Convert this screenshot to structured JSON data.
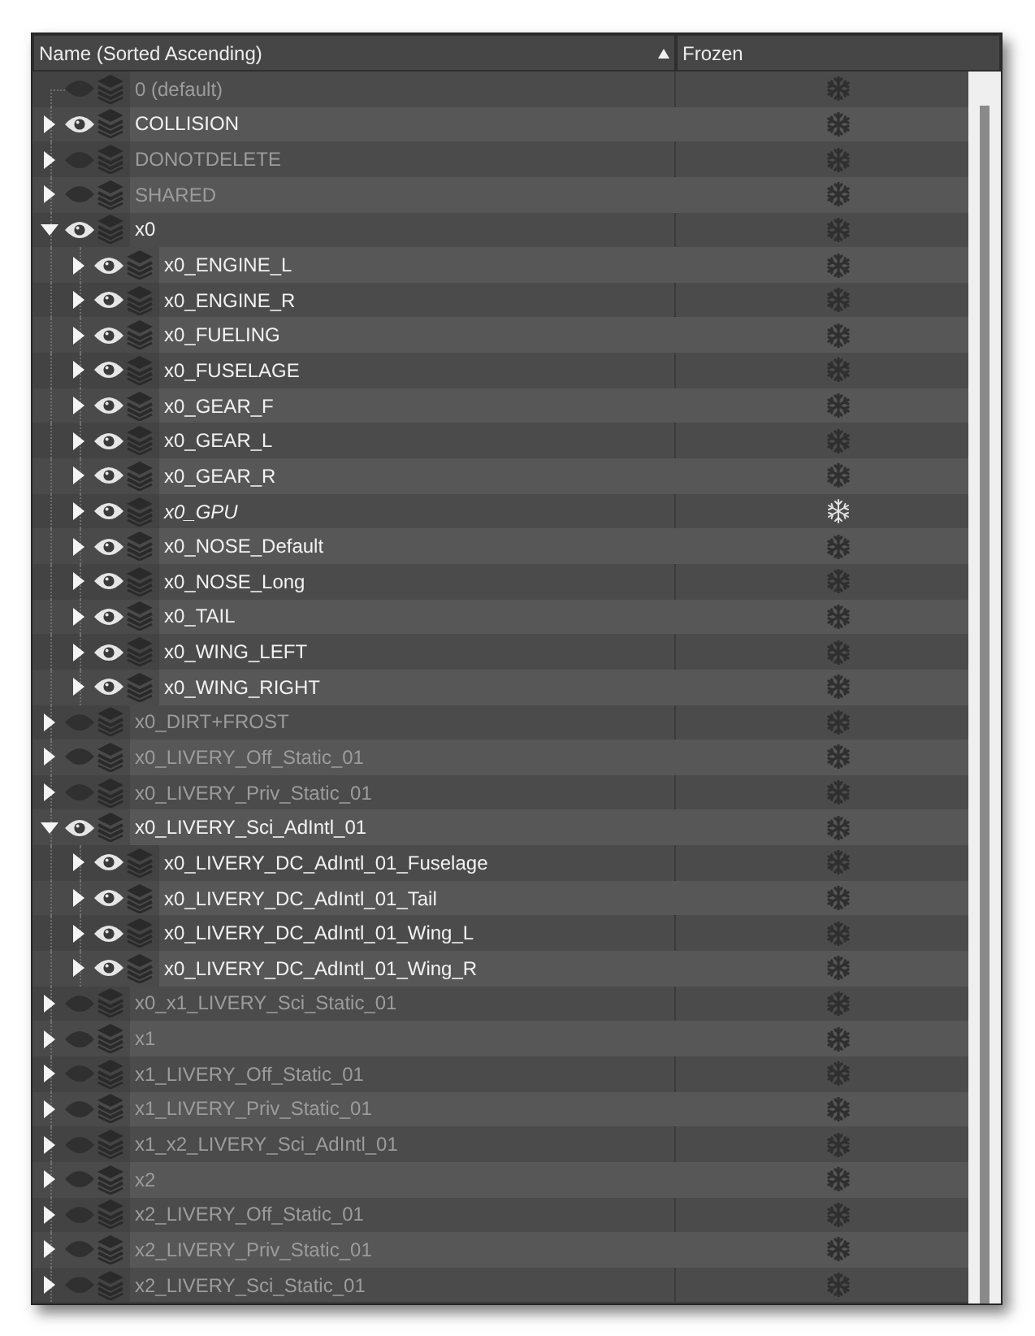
{
  "columns": [
    {
      "label": "Name (Sorted Ascending)",
      "sorted": true
    },
    {
      "label": "Frozen",
      "sorted": false
    }
  ],
  "rows": [
    {
      "name": "0 (default)",
      "kind": "default",
      "visible": false,
      "frozen": false
    },
    {
      "name": "COLLISION",
      "kind": "layer",
      "expanded": false,
      "visible": true,
      "frozen": false
    },
    {
      "name": "DONOTDELETE",
      "kind": "layer",
      "expanded": false,
      "visible": false,
      "frozen": false
    },
    {
      "name": "SHARED",
      "kind": "layer",
      "expanded": false,
      "visible": false,
      "frozen": false
    },
    {
      "name": "x0",
      "kind": "layer",
      "expanded": true,
      "visible": true,
      "frozen": false,
      "children": [
        {
          "name": "x0_ENGINE_L",
          "kind": "layer",
          "expanded": false,
          "visible": true,
          "frozen": false
        },
        {
          "name": "x0_ENGINE_R",
          "kind": "layer",
          "expanded": false,
          "visible": true,
          "frozen": false
        },
        {
          "name": "x0_FUELING",
          "kind": "layer",
          "expanded": false,
          "visible": true,
          "frozen": false
        },
        {
          "name": "x0_FUSELAGE",
          "kind": "layer",
          "expanded": false,
          "visible": true,
          "frozen": false
        },
        {
          "name": "x0_GEAR_F",
          "kind": "layer",
          "expanded": false,
          "visible": true,
          "frozen": false
        },
        {
          "name": "x0_GEAR_L",
          "kind": "layer",
          "expanded": false,
          "visible": true,
          "frozen": false
        },
        {
          "name": "x0_GEAR_R",
          "kind": "layer",
          "expanded": false,
          "visible": true,
          "frozen": false
        },
        {
          "name": "x0_GPU",
          "kind": "layer",
          "expanded": false,
          "visible": true,
          "frozen": true
        },
        {
          "name": "x0_NOSE_Default",
          "kind": "layer",
          "expanded": false,
          "visible": true,
          "frozen": false
        },
        {
          "name": "x0_NOSE_Long",
          "kind": "layer",
          "expanded": false,
          "visible": true,
          "frozen": false
        },
        {
          "name": "x0_TAIL",
          "kind": "layer",
          "expanded": false,
          "visible": true,
          "frozen": false
        },
        {
          "name": "x0_WING_LEFT",
          "kind": "layer",
          "expanded": false,
          "visible": true,
          "frozen": false
        },
        {
          "name": "x0_WING_RIGHT",
          "kind": "layer",
          "expanded": false,
          "visible": true,
          "frozen": false
        }
      ]
    },
    {
      "name": "x0_DIRT+FROST",
      "kind": "layer",
      "expanded": false,
      "visible": false,
      "frozen": false
    },
    {
      "name": "x0_LIVERY_Off_Static_01",
      "kind": "layer",
      "expanded": false,
      "visible": false,
      "frozen": false
    },
    {
      "name": "x0_LIVERY_Priv_Static_01",
      "kind": "layer",
      "expanded": false,
      "visible": false,
      "frozen": false
    },
    {
      "name": "x0_LIVERY_Sci_AdIntl_01",
      "kind": "layer",
      "expanded": true,
      "visible": true,
      "frozen": false,
      "children": [
        {
          "name": "x0_LIVERY_DC_AdIntl_01_Fuselage",
          "kind": "layer",
          "expanded": false,
          "visible": true,
          "frozen": false
        },
        {
          "name": "x0_LIVERY_DC_AdIntl_01_Tail",
          "kind": "layer",
          "expanded": false,
          "visible": true,
          "frozen": false
        },
        {
          "name": "x0_LIVERY_DC_AdIntl_01_Wing_L",
          "kind": "layer",
          "expanded": false,
          "visible": true,
          "frozen": false
        },
        {
          "name": "x0_LIVERY_DC_AdIntl_01_Wing_R",
          "kind": "layer",
          "expanded": false,
          "visible": true,
          "frozen": false
        }
      ]
    },
    {
      "name": "x0_x1_LIVERY_Sci_Static_01",
      "kind": "layer",
      "expanded": false,
      "visible": false,
      "frozen": false
    },
    {
      "name": "x1",
      "kind": "layer",
      "expanded": false,
      "visible": false,
      "frozen": false
    },
    {
      "name": "x1_LIVERY_Off_Static_01",
      "kind": "layer",
      "expanded": false,
      "visible": false,
      "frozen": false
    },
    {
      "name": "x1_LIVERY_Priv_Static_01",
      "kind": "layer",
      "expanded": false,
      "visible": false,
      "frozen": false
    },
    {
      "name": "x1_x2_LIVERY_Sci_AdIntl_01",
      "kind": "layer",
      "expanded": false,
      "visible": false,
      "frozen": false
    },
    {
      "name": "x2",
      "kind": "layer",
      "expanded": false,
      "visible": false,
      "frozen": false
    },
    {
      "name": "x2_LIVERY_Off_Static_01",
      "kind": "layer",
      "expanded": false,
      "visible": false,
      "frozen": false
    },
    {
      "name": "x2_LIVERY_Priv_Static_01",
      "kind": "layer",
      "expanded": false,
      "visible": false,
      "frozen": false
    },
    {
      "name": "x2_LIVERY_Sci_Static_01",
      "kind": "layer",
      "expanded": false,
      "visible": false,
      "frozen": false
    }
  ]
}
